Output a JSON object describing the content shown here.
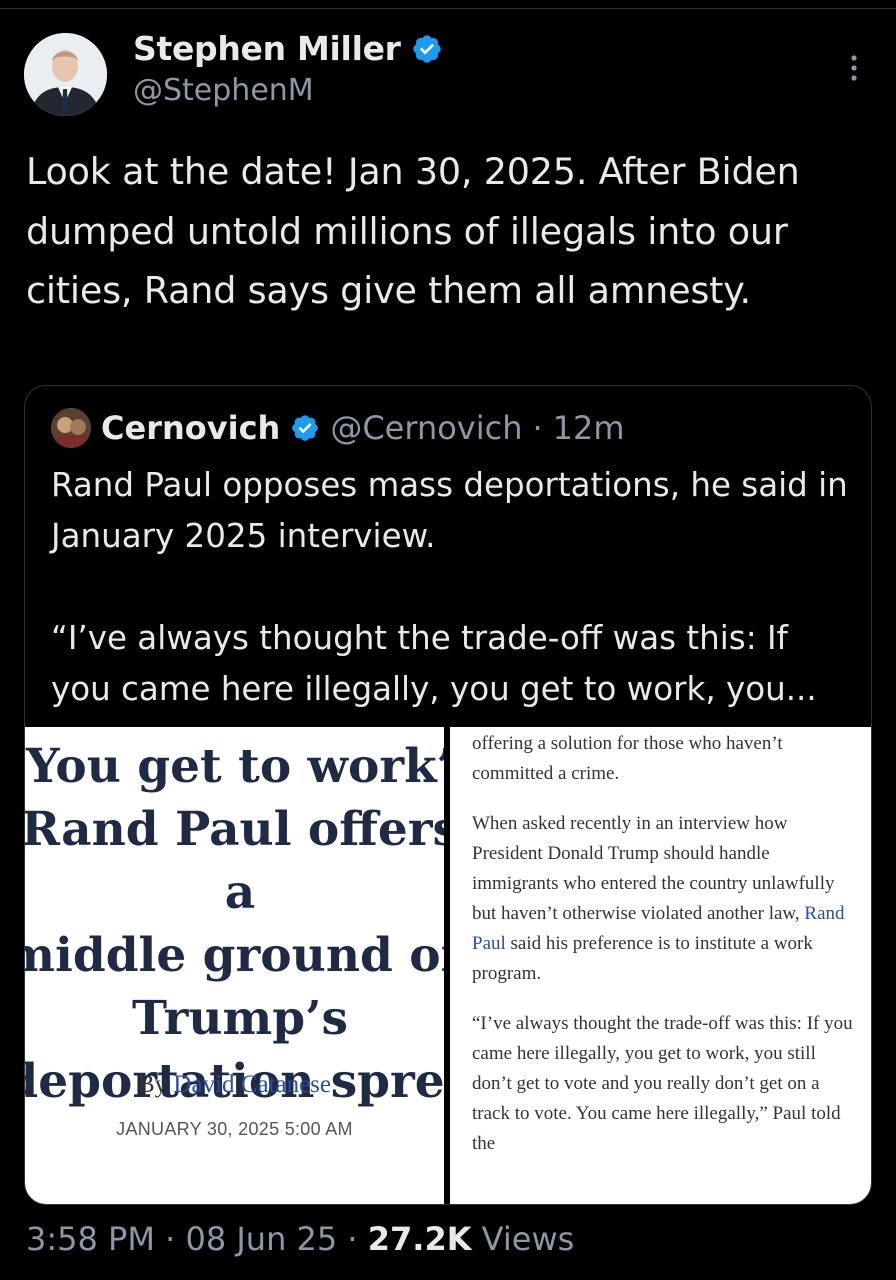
{
  "author": {
    "name": "Stephen Miller",
    "handle": "@StephenM",
    "verified_icon": "verified-badge-icon",
    "avatar_icon": "profile-avatar"
  },
  "tweet": {
    "text": "Look at the date! Jan 30, 2025. After Biden dumped untold millions of illegals into our cities, Rand says give them all amnesty."
  },
  "quote": {
    "name": "Cernovich",
    "handle": "@Cernovich",
    "sep": "·",
    "time": "12m",
    "text_line1": "Rand Paul opposes mass deportations, he said in January 2025 interview.",
    "text_line2": "“I’ve always thought the trade-off was this: If you came here illegally, you get to work, you..."
  },
  "article_left": {
    "headline_lines": [
      "‘You get to work’:",
      "Rand Paul offers a",
      "middle ground on",
      "Trump’s",
      "deportation spree"
    ],
    "by": "By",
    "author": "David Catanese",
    "date": "JANUARY 30, 2025 5:00 AM"
  },
  "article_right": {
    "p1": "offering a solution for those who haven’t committed a crime.",
    "p2_a": "When asked recently in an interview how President Donald Trump should handle immigrants who entered the country unlawfully but haven’t otherwise violated another law,",
    "p2_link": "Rand Paul",
    "p2_b": "said his preference is to institute a work program.",
    "p3": "“I’ve always thought the trade-off was this: If you came here illegally, you get to work, you still don’t get to vote and you really don’t get on a track to vote. You came here illegally,” Paul told the"
  },
  "footer": {
    "time": "3:58 PM",
    "sep": "·",
    "date": "08 Jun 25",
    "views_count": "27.2K",
    "views_label": "Views"
  },
  "colors": {
    "background": "#000000",
    "text": "#e7e9ea",
    "muted": "#8b98a5",
    "verified": "#1d9bf0",
    "link": "#2a4d9c"
  }
}
